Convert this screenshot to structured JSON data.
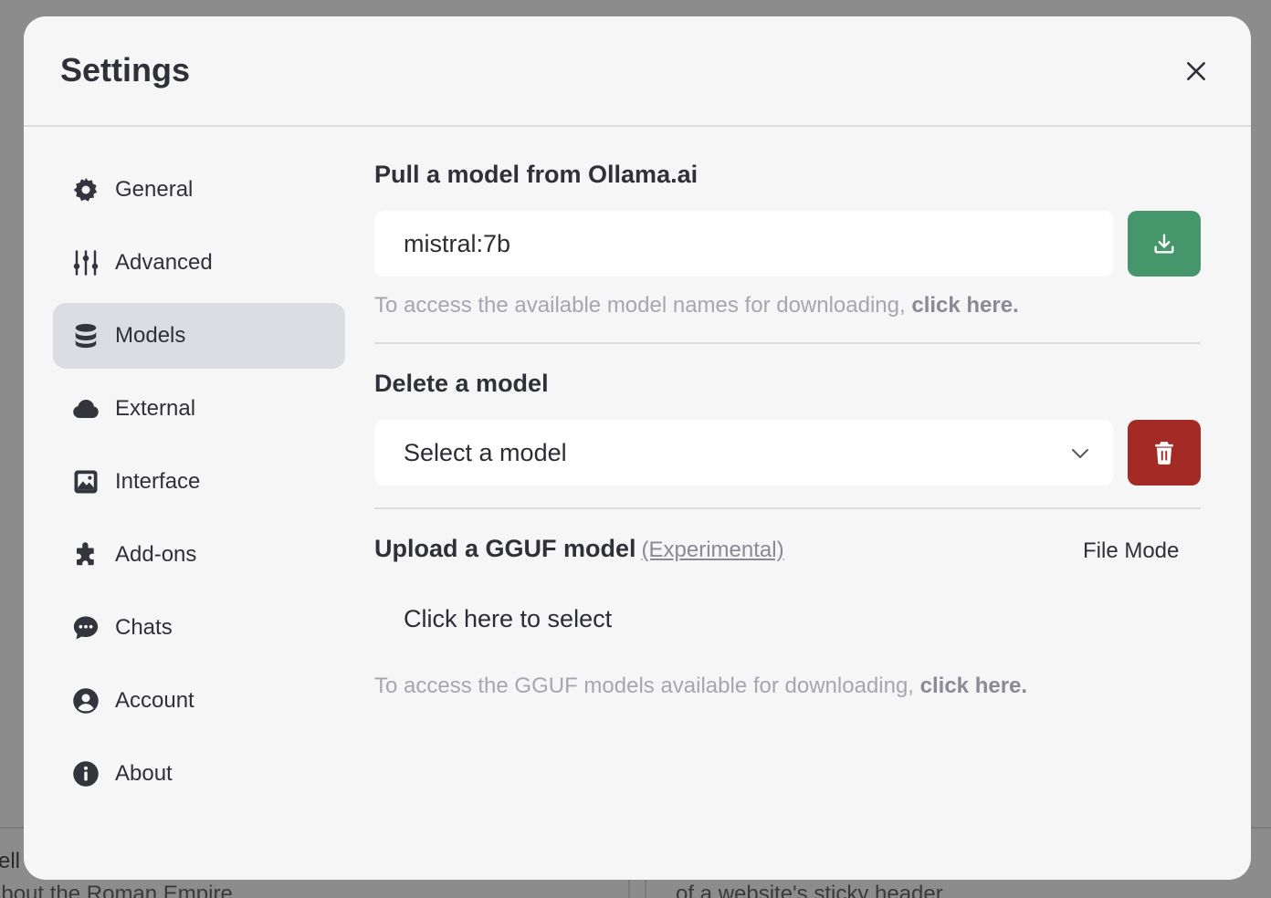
{
  "background": {
    "snippet_a": "ell",
    "snippet_b": "about the Roman Empire",
    "snippet_c": "of a website's sticky header"
  },
  "modal": {
    "title": "Settings",
    "close_icon": "close-icon"
  },
  "sidebar": {
    "items": [
      {
        "label": "General",
        "icon": "gear-icon"
      },
      {
        "label": "Advanced",
        "icon": "sliders-icon"
      },
      {
        "label": "Models",
        "icon": "database-icon",
        "active": true
      },
      {
        "label": "External",
        "icon": "cloud-icon"
      },
      {
        "label": "Interface",
        "icon": "image-icon"
      },
      {
        "label": "Add-ons",
        "icon": "puzzle-icon"
      },
      {
        "label": "Chats",
        "icon": "chat-icon"
      },
      {
        "label": "Account",
        "icon": "user-circle-icon"
      },
      {
        "label": "About",
        "icon": "info-icon"
      }
    ]
  },
  "pull": {
    "title": "Pull a model from Ollama.ai",
    "input_value": "mistral:7b",
    "hint_text": "To access the available model names for downloading, ",
    "hint_link": "click here."
  },
  "delete": {
    "title": "Delete a model",
    "select_value": "Select a model"
  },
  "upload": {
    "title": "Upload a GGUF model",
    "experimental": "(Experimental)",
    "mode_label": "File Mode",
    "select_label": "Click here to select",
    "hint_text": "To access the GGUF models available for downloading, ",
    "hint_link": "click here."
  },
  "colors": {
    "download_button": "#45966a",
    "delete_button": "#a42b25",
    "active_nav": "#dcdce3"
  }
}
